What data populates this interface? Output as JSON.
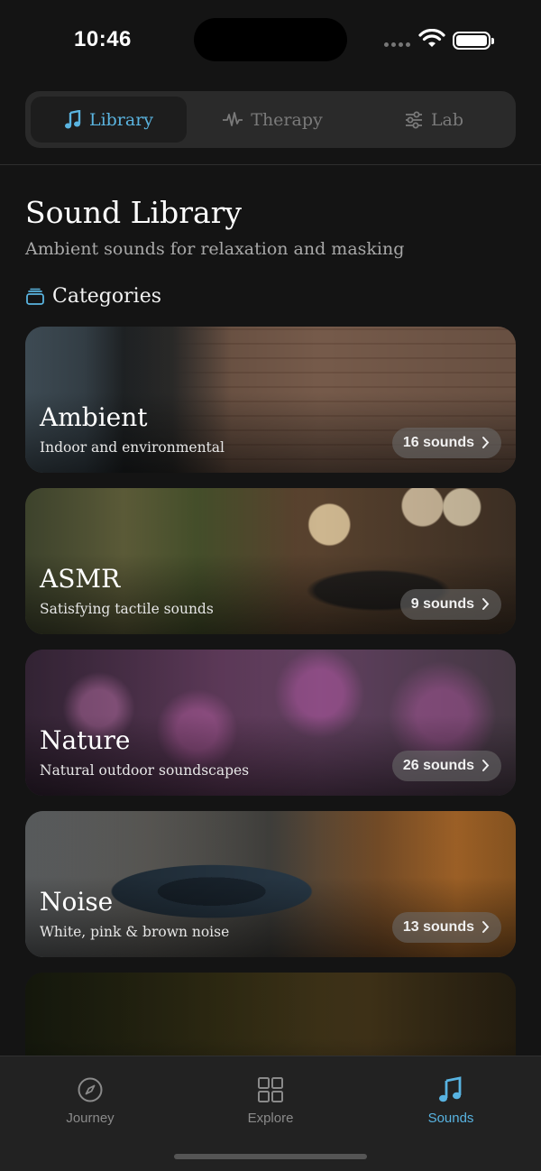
{
  "status": {
    "time": "10:46"
  },
  "segments": [
    {
      "label": "Library",
      "icon": "music-note-icon",
      "active": true
    },
    {
      "label": "Therapy",
      "icon": "waveform-icon",
      "active": false
    },
    {
      "label": "Lab",
      "icon": "sliders-icon",
      "active": false
    }
  ],
  "header": {
    "title": "Sound Library",
    "subtitle": "Ambient sounds for relaxation and masking"
  },
  "section": {
    "label": "Categories",
    "icon": "stack-icon"
  },
  "categories": [
    {
      "title": "Ambient",
      "description": "Indoor and environmental",
      "count": "16 sounds"
    },
    {
      "title": "ASMR",
      "description": "Satisfying tactile sounds",
      "count": "9 sounds"
    },
    {
      "title": "Nature",
      "description": "Natural outdoor soundscapes",
      "count": "26 sounds"
    },
    {
      "title": "Noise",
      "description": "White, pink & brown noise",
      "count": "13 sounds"
    }
  ],
  "tabbar": [
    {
      "label": "Journey",
      "icon": "compass-icon",
      "active": false
    },
    {
      "label": "Explore",
      "icon": "grid-icon",
      "active": false
    },
    {
      "label": "Sounds",
      "icon": "music-note-icon",
      "active": true
    }
  ],
  "colors": {
    "accent": "#58b3e1",
    "background": "#141414"
  }
}
